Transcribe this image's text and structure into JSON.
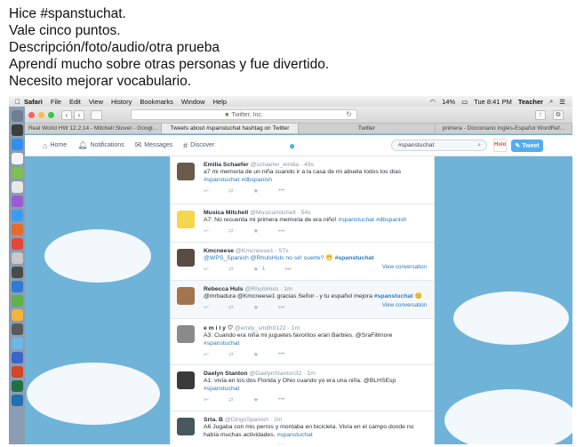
{
  "caption": {
    "lines": [
      "Hice #spanstuchat.",
      "Vale cinco puntos.",
      "Descripción/foto/audio/otra prueba",
      "Aprendí mucho sobre otras personas y fue divertido.",
      "Necesito mejorar vocabulario."
    ]
  },
  "menubar": {
    "app": "Safari",
    "items": [
      "File",
      "Edit",
      "View",
      "History",
      "Bookmarks",
      "Window",
      "Help"
    ],
    "battery": "14%",
    "clock": "Tue 8:41 PM",
    "user": "Teacher"
  },
  "toolbar": {
    "url": "Twitter, Inc."
  },
  "tabs": [
    "Real World HW 12.2.14 - Mitchell Stover - Googl...",
    "Tweets about #spanstuchat hashtag on Twitter",
    "Twitter",
    "primera - Diccionario Inglés-Español WordRef..."
  ],
  "twitter": {
    "nav": {
      "home": "Home",
      "notifications": "Notifications",
      "messages": "Messages",
      "discover": "Discover"
    },
    "search_value": "#spanstuchat",
    "avatar_text": "Holo",
    "tweet_button": "Tweet"
  },
  "tweets": [
    {
      "name": "Emilia Schaefer",
      "meta": "@schaefer_emilia · 49s",
      "text": "a7 mi memoria de un niña cuando ir a la casa de mi abuela todos los días",
      "tags": "#spanstuchat #dbspanish"
    },
    {
      "name": "Musica Mitchell",
      "meta": "@Musicamitchell · 54s",
      "text": "A7: No recuerda mi primera memoria de era niño!",
      "tags": "#spanstuchat #dbspanish"
    },
    {
      "name": "Kmcneese",
      "meta": "@Kmcneese1 · 57s",
      "text": "@WPS_Spanish @RhulsHuls no sé! suerte? 😁",
      "tags": "#spanstuchat",
      "count": "1",
      "view": "View conversation"
    },
    {
      "name": "Rebecca Huls",
      "meta": "@RhulsHuls · 1m",
      "text": "@mrbadura @Kmcneese1 gracias Señor - y tu español mejora",
      "tags": "#spanstuchat 😊",
      "view": "View conversation"
    },
    {
      "name": "e m i l y ♡",
      "meta": "@emily_smith0122 · 1m",
      "text": "A3: Cuando era niña mi juguetes favoritos eran Barbies. @SraFillmore",
      "tags": "#spanstuchat"
    },
    {
      "name": "Daelyn Stanton",
      "meta": "@DaelynStanton32 · 1m",
      "text": "A1: vivía en los dos Florida y Ohio cuando yo era una niña. @BLHSEsp",
      "tags": "#spanstuchat"
    },
    {
      "name": "Srta. B",
      "meta": "@DirigoSpanish · 2m",
      "text": "A6 Jugaba con mis perros y montaba en bicicleta. Vivía en el campo donde no había muchas actividades.",
      "tags": "#spanstuchat"
    }
  ],
  "colors": {
    "twitter_blue": "#55acee",
    "hashtag_blue": "#2b7bb9",
    "sky": "#6fb3d9"
  }
}
